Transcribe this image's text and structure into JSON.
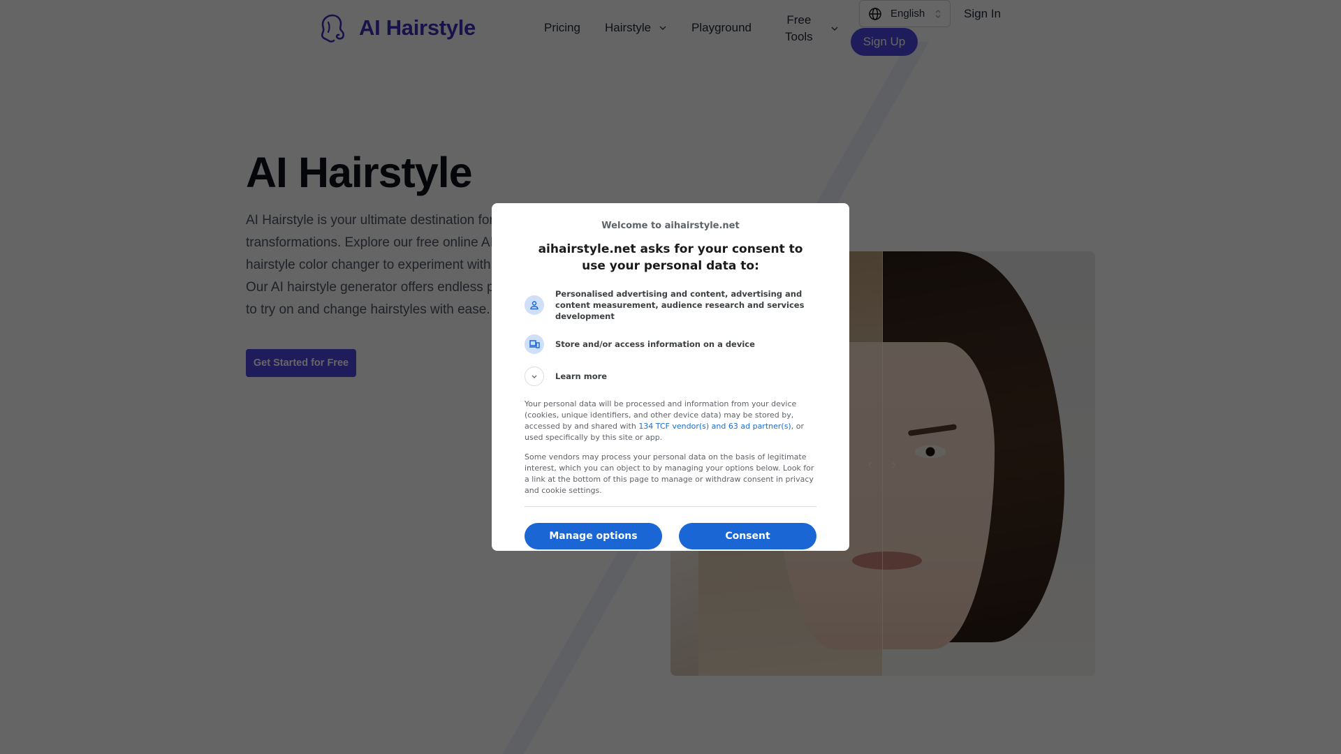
{
  "header": {
    "logo_text": "AI Hairstyle",
    "nav": {
      "pricing": "Pricing",
      "hairstyle": "Hairstyle",
      "playground": "Playground",
      "free_tools_line1": "Free",
      "free_tools_line2": "Tools"
    },
    "language": "English",
    "sign_in": "Sign In",
    "sign_up": "Sign Up"
  },
  "hero": {
    "title": "AI Hairstyle",
    "description": "AI Hairstyle is your ultimate destination for transformations. Explore our free online AI hairstyle color changer to experiment with Our AI hairstyle generator offers endless p to try on and change hairstyles with ease.",
    "lines": [
      "AI Hairstyle is your ultimate destination for",
      "transformations. Explore our free online AI",
      "hairstyle color changer to experiment with",
      "Our AI hairstyle generator offers endless p",
      "to try on and change hairstyles with ease."
    ],
    "cta": "Get Started for Free"
  },
  "compare": {
    "prev_arrow": "‹",
    "next_arrow": "›"
  },
  "consent": {
    "welcome": "Welcome to aihairstyle.net",
    "title": "aihairstyle.net asks for your consent to use your personal data to:",
    "purposes": [
      {
        "icon": "person-icon",
        "text": "Personalised advertising and content, advertising and content measurement, audience research and services development"
      },
      {
        "icon": "devices-icon",
        "text": "Store and/or access information on a device"
      }
    ],
    "learn_more": "Learn more",
    "para1_before": "Your personal data will be processed and information from your device (cookies, unique identifiers, and other device data) may be stored by, accessed by and shared with ",
    "para1_link": "134 TCF vendor(s) and 63 ad partner(s)",
    "para1_after": ", or used specifically by this site or app.",
    "para2": "Some vendors may process your personal data on the basis of legitimate interest, which you can object to by managing your options below. Look for a link at the bottom of this page to manage or withdraw consent in privacy and cookie settings.",
    "manage_options": "Manage options",
    "consent_button": "Consent"
  },
  "colors": {
    "brand": "#4f46e5",
    "consent_blue": "#1a66d4",
    "link_blue": "#1a6dd6"
  }
}
